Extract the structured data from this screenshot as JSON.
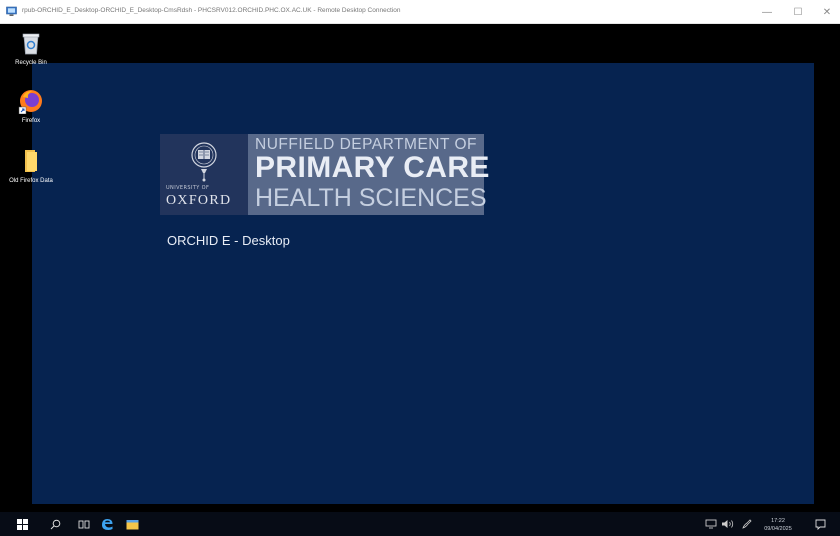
{
  "window": {
    "title": "rpub-ORCHID_E_Desktop-ORCHID_E_Desktop-CmsRdsh - PHCSRV012.ORCHID.PHC.OX.AC.UK - Remote Desktop Connection",
    "icon": "remote-desktop-icon",
    "controls": {
      "minimize": "—",
      "maximize": "☐",
      "close": "✕"
    }
  },
  "desktop_icons": [
    {
      "label": "Recycle Bin",
      "icon": "recycle-bin-icon"
    },
    {
      "label": "Firefox",
      "icon": "firefox-icon"
    },
    {
      "label": "Old Firefox Data",
      "icon": "folder-icon"
    }
  ],
  "logo": {
    "university_line": "UNIVERSITY OF",
    "university_name": "OXFORD",
    "department_line": "NUFFIELD DEPARTMENT OF",
    "primary_line": "PRIMARY CARE",
    "health_line": "HEALTH SCIENCES"
  },
  "caption": "ORCHID E - Desktop",
  "taskbar": {
    "items": [
      "start-icon",
      "search-icon",
      "task-view-icon",
      "edge-icon",
      "file-explorer-icon"
    ],
    "tray": [
      "network-icon",
      "volume-icon",
      "pen-icon"
    ],
    "time": "17:22",
    "date": "09/04/2025",
    "notification": "notification-icon"
  },
  "colors": {
    "wallpaper": "#062350",
    "logo_left": "#22345c",
    "logo_right": "#58698a",
    "taskbar": "#070c16"
  }
}
